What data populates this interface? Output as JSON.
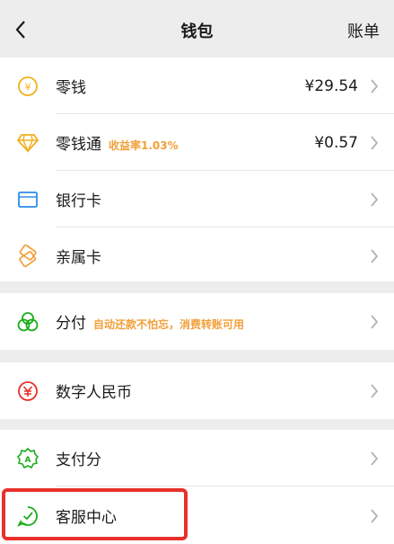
{
  "header": {
    "title": "钱包",
    "bills_label": "账单"
  },
  "items": [
    {
      "label": "零钱",
      "value": "¥29.54",
      "icon": "coin-icon"
    },
    {
      "label": "零钱通",
      "badge": "收益率1.03%",
      "value": "¥0.57",
      "icon": "diamond-icon"
    },
    {
      "label": "银行卡",
      "icon": "bank-card-icon"
    },
    {
      "label": "亲属卡",
      "icon": "family-card-icon"
    },
    {
      "label": "分付",
      "badge": "自动还款不怕忘，消费转账可用",
      "icon": "fenfu-icon"
    },
    {
      "label": "数字人民币",
      "icon": "digital-rmb-icon"
    },
    {
      "label": "支付分",
      "icon": "pay-score-icon"
    },
    {
      "label": "客服中心",
      "icon": "customer-service-icon"
    }
  ],
  "colors": {
    "accent_yellow": "#f2b01e",
    "accent_green": "#1aad19",
    "accent_blue": "#2b8de6",
    "accent_orange": "#f2a03a",
    "accent_red": "#e8312a",
    "highlight": "#e8312a"
  }
}
